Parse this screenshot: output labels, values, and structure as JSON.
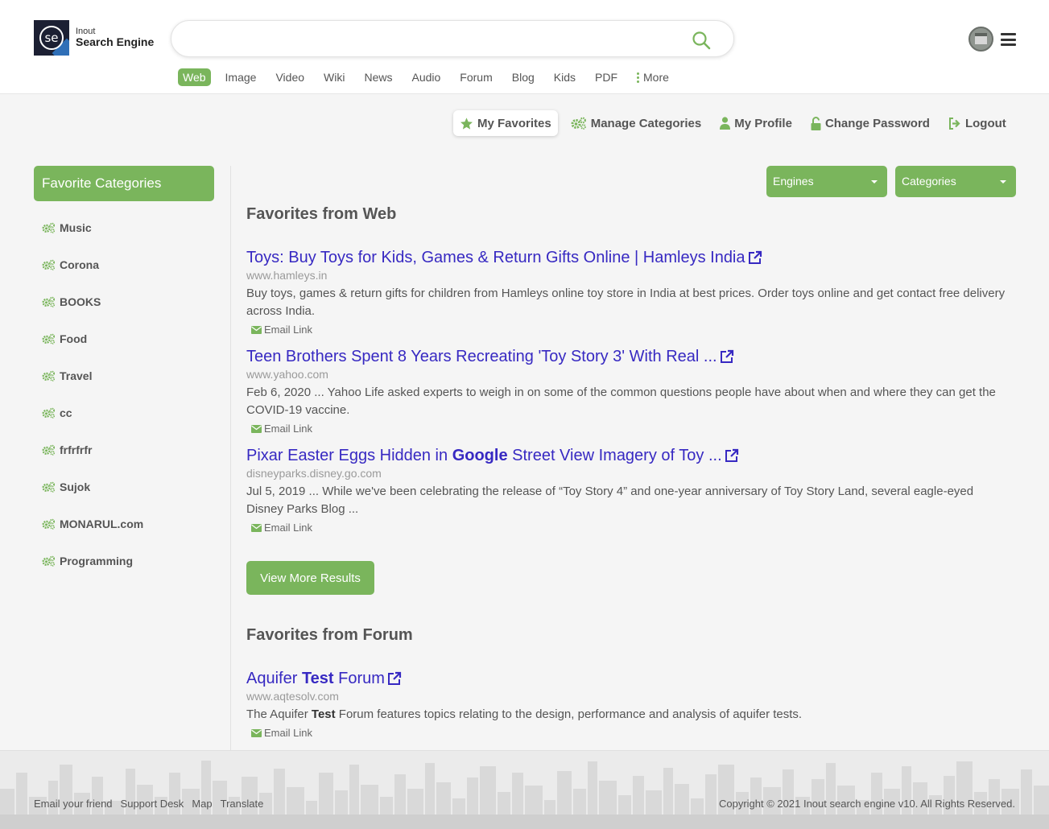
{
  "colors": {
    "accent": "#7ab55c",
    "link": "#3729c2",
    "url": "#9a9a9a"
  },
  "logo": {
    "mark": "se",
    "small": "Inout",
    "big": "Search Engine"
  },
  "search": {
    "value": "",
    "placeholder": ""
  },
  "tabs": [
    {
      "label": "Web",
      "active": true
    },
    {
      "label": "Image"
    },
    {
      "label": "Video"
    },
    {
      "label": "Wiki"
    },
    {
      "label": "News"
    },
    {
      "label": "Audio"
    },
    {
      "label": "Forum"
    },
    {
      "label": "Blog"
    },
    {
      "label": "Kids"
    },
    {
      "label": "PDF"
    },
    {
      "label": "More"
    }
  ],
  "userbar": {
    "favorites": "My Favorites",
    "manage": "Manage Categories",
    "profile": "My Profile",
    "password": "Change Password",
    "logout": "Logout"
  },
  "sidebar": {
    "title": "Favorite Categories",
    "items": [
      "Music",
      "Corona",
      "BOOKS",
      "Food",
      "Travel",
      "cc",
      "frfrfrfr",
      "Sujok",
      "MONARUL.com",
      "Programming"
    ]
  },
  "filters": {
    "engines": "Engines",
    "categories": "Categories"
  },
  "sections": {
    "web_title": "Favorites from Web",
    "forum_title": "Favorites from Forum"
  },
  "web_results": [
    {
      "title_parts": [
        "Toys: Buy Toys for Kids, Games & Return Gifts Online | Hamleys India"
      ],
      "url": "www.hamleys.in",
      "desc": "Buy toys, games & return gifts for children from Hamleys online toy store in India at best prices. Order toys online and get contact free delivery across India.",
      "email": "Email Link"
    },
    {
      "title_parts": [
        "Teen Brothers Spent 8 Years Recreating 'Toy Story 3' With Real ..."
      ],
      "url": "www.yahoo.com",
      "desc": "Feb 6, 2020 ... Yahoo Life asked experts to weigh in on some of the common questions people have about when and where they can get the COVID-19 vaccine.",
      "email": "Email Link"
    },
    {
      "title_parts": [
        "Pixar Easter Eggs Hidden in ",
        "Google",
        " Street View Imagery of Toy ..."
      ],
      "url": "disneyparks.disney.go.com",
      "desc": "Jul 5, 2019 ... While we've been celebrating the release of “Toy Story 4” and one-year anniversary of Toy Story Land, several eagle-eyed Disney Parks Blog ...",
      "email": "Email Link"
    }
  ],
  "view_more": "View More Results",
  "forum_results": [
    {
      "title_parts": [
        "Aquifer ",
        "Test",
        " Forum"
      ],
      "url": "www.aqtesolv.com",
      "desc_parts": [
        "The Aquifer ",
        "Test",
        " Forum features topics relating to the design, performance and analysis of aquifer tests."
      ],
      "email": "Email Link"
    }
  ],
  "footer": {
    "links": [
      "Email your friend",
      "Support Desk",
      "Map",
      "Translate"
    ],
    "copyright": "Copyright © 2021 Inout search engine v10. All Rights Reserved."
  }
}
